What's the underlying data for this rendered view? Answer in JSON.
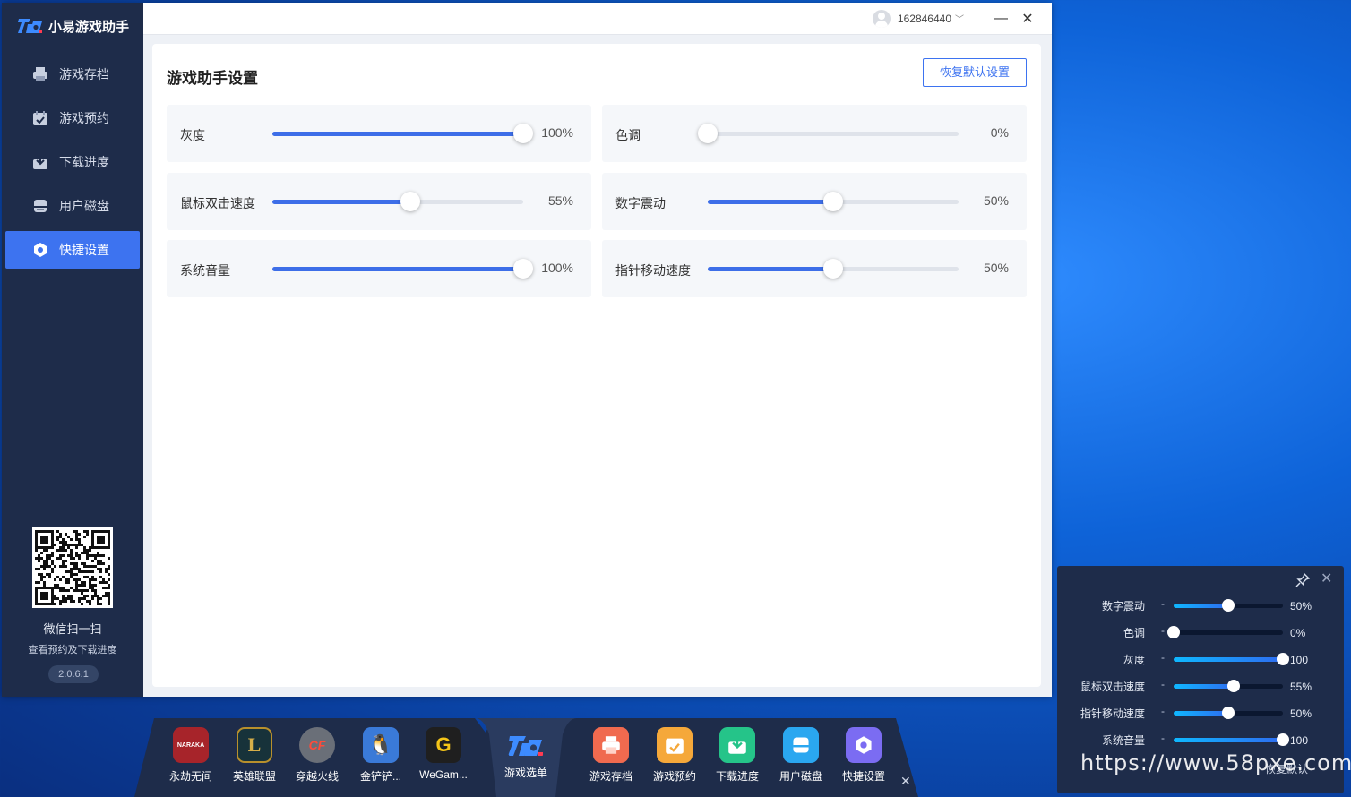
{
  "app": {
    "name": "小易游戏助手",
    "version": "2.0.6.1"
  },
  "sidebar": {
    "items": [
      {
        "label": "游戏存档",
        "icon": "printer-icon"
      },
      {
        "label": "游戏预约",
        "icon": "calendar-icon"
      },
      {
        "label": "下载进度",
        "icon": "download-icon"
      },
      {
        "label": "用户磁盘",
        "icon": "disk-icon"
      },
      {
        "label": "快捷设置",
        "icon": "settings-icon",
        "active": true
      }
    ],
    "qr_caption": "微信扫一扫",
    "qr_subcaption": "查看预约及下载进度"
  },
  "titlebar": {
    "user_id": "162846440",
    "minimize": "—",
    "close": "✕"
  },
  "panel": {
    "title": "游戏助手设置",
    "reset_label": "恢复默认设置",
    "settings": [
      {
        "label": "灰度",
        "value": 100,
        "display": "100%"
      },
      {
        "label": "色调",
        "value": 0,
        "display": "0%"
      },
      {
        "label": "鼠标双击速度",
        "value": 55,
        "display": "55%"
      },
      {
        "label": "数字震动",
        "value": 50,
        "display": "50%"
      },
      {
        "label": "系统音量",
        "value": 100,
        "display": "100%"
      },
      {
        "label": "指针移动速度",
        "value": 50,
        "display": "50%"
      }
    ]
  },
  "dock": {
    "games": [
      {
        "label": "永劫无间",
        "badge": "NARAKA",
        "color": "#a7242a"
      },
      {
        "label": "英雄联盟",
        "badge": "L",
        "color": "#17323a"
      },
      {
        "label": "穿越火线",
        "badge": "CF",
        "color": "#6a6f78"
      },
      {
        "label": "金铲铲...",
        "badge": "🐧",
        "color": "#3a7ad8"
      },
      {
        "label": "WeGam...",
        "badge": "G",
        "color": "#1f1f1f"
      }
    ],
    "center": {
      "label": "游戏选单"
    },
    "tools": [
      {
        "label": "游戏存档",
        "color": "#f06a4f",
        "icon": "printer-icon"
      },
      {
        "label": "游戏预约",
        "color": "#f5a83a",
        "icon": "calendar-icon"
      },
      {
        "label": "下载进度",
        "color": "#25c489",
        "icon": "download-icon"
      },
      {
        "label": "用户磁盘",
        "color": "#2aa7f0",
        "icon": "disk-icon"
      },
      {
        "label": "快捷设置",
        "color": "#7b6cf2",
        "icon": "settings-icon"
      }
    ],
    "close": "✕"
  },
  "floating": {
    "rows": [
      {
        "label": "数字震动",
        "dash": "-",
        "value": 50,
        "display": "50%"
      },
      {
        "label": "色调",
        "dash": "-",
        "value": 0,
        "display": "0%"
      },
      {
        "label": "灰度",
        "dash": "-",
        "value": 100,
        "display": "100"
      },
      {
        "label": "鼠标双击速度",
        "dash": "-",
        "value": 55,
        "display": "55%"
      },
      {
        "label": "指针移动速度",
        "dash": "-",
        "value": 50,
        "display": "50%"
      },
      {
        "label": "系统音量",
        "dash": "-",
        "value": 100,
        "display": "100"
      }
    ],
    "close": "✕",
    "reset_label": "恢复默认"
  },
  "watermark": "https://www.58pxe.com",
  "colors": {
    "accent": "#3d73f0",
    "sidebar_bg": "#1e2c4a",
    "card_bg": "#f5f7fa"
  }
}
